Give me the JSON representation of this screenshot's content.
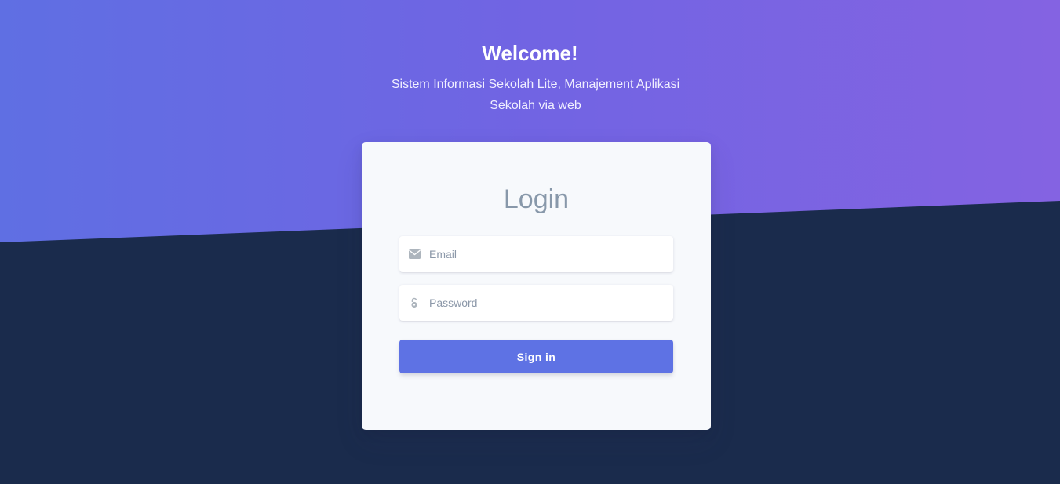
{
  "header": {
    "title": "Welcome!",
    "subtitle": "Sistem Informasi Sekolah Lite, Manajement Aplikasi Sekolah via web"
  },
  "login": {
    "title": "Login",
    "email": {
      "placeholder": "Email",
      "value": "",
      "icon": "envelope-icon"
    },
    "password": {
      "placeholder": "Password",
      "value": "",
      "icon": "lock-icon"
    },
    "submit_label": "Sign in"
  },
  "colors": {
    "gradient_start": "#5f6fe3",
    "gradient_end": "#8463e2",
    "background_dark": "#1a2b4c",
    "card_bg": "#f7f9fc",
    "button_primary": "#5e72e4",
    "title_gray": "#8898aa"
  }
}
